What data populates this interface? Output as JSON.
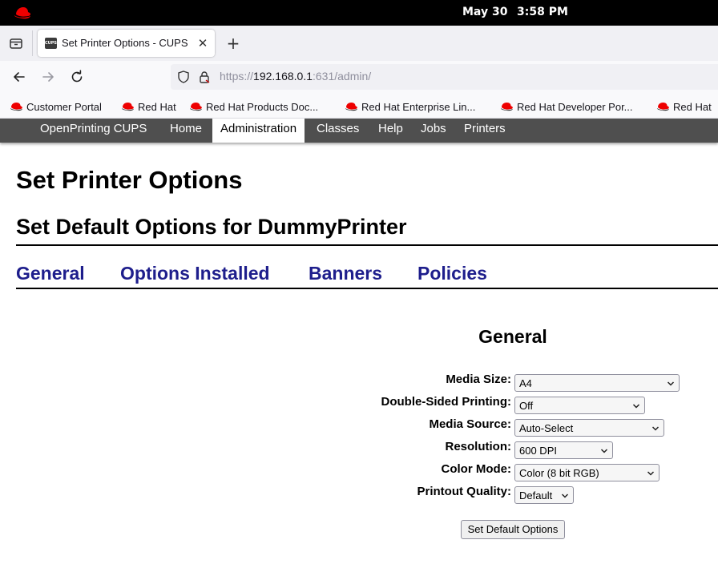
{
  "system": {
    "date": "May 30",
    "time": "3:58 PM"
  },
  "browser": {
    "tab_title": "Set Printer Options - CUPS",
    "favicon_text": "CUPS",
    "url_scheme": "https://",
    "url_host": "192.168.0.1",
    "url_rest": ":631/admin/"
  },
  "bookmarks": [
    {
      "label": "Customer Portal"
    },
    {
      "label": "Red Hat"
    },
    {
      "label": "Red Hat Products Doc..."
    },
    {
      "label": "Red Hat Enterprise Lin..."
    },
    {
      "label": "Red Hat Developer Por..."
    },
    {
      "label": "Red Hat"
    }
  ],
  "cups_nav": {
    "brand": "OpenPrinting CUPS",
    "items": [
      "Home",
      "Administration",
      "Classes",
      "Help",
      "Jobs",
      "Printers"
    ],
    "active": "Administration"
  },
  "page": {
    "title": "Set Printer Options",
    "subtitle": "Set Default Options for DummyPrinter",
    "tabs": [
      "General",
      "Options Installed",
      "Banners",
      "Policies"
    ],
    "section_title": "General",
    "options": [
      {
        "label": "Media Size:",
        "value": "A4"
      },
      {
        "label": "Double-Sided Printing:",
        "value": "Off"
      },
      {
        "label": "Media Source:",
        "value": "Auto-Select"
      },
      {
        "label": "Resolution:",
        "value": "600 DPI"
      },
      {
        "label": "Color Mode:",
        "value": "Color (8 bit RGB)"
      },
      {
        "label": "Printout Quality:",
        "value": "Default"
      }
    ],
    "submit_label": "Set Default Options"
  },
  "colors": {
    "cups_nav_bg": "#4f4f4f",
    "tab_link": "#1e1e8c",
    "redhat_red": "#ee0000"
  }
}
